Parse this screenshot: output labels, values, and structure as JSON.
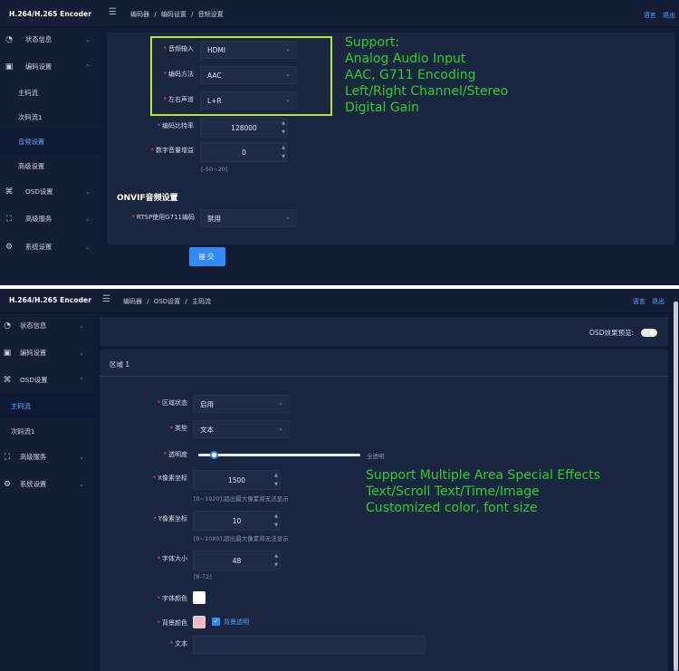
{
  "top": {
    "brand": "H.264/H.265 Encoder",
    "breadcrumb": [
      "编码器",
      "/",
      "编码设置",
      "/",
      "音频设置"
    ],
    "links": [
      "语言",
      "退出"
    ],
    "sidebar": [
      {
        "label": "状态信息",
        "icon": "gauge-icon"
      },
      {
        "label": "编码设置",
        "icon": "monitor-icon"
      },
      {
        "label": "主码流",
        "icon": ""
      },
      {
        "label": "次码流1",
        "icon": ""
      },
      {
        "label": "音频设置",
        "icon": ""
      },
      {
        "label": "高级设置",
        "icon": ""
      },
      {
        "label": "OSD设置",
        "icon": "osd-icon"
      },
      {
        "label": "高级服务",
        "icon": "service-icon"
      },
      {
        "label": "系统设置",
        "icon": "gear-icon"
      }
    ],
    "form": {
      "audio_input_label": "音频输入",
      "audio_input_value": "HDMI",
      "codec_label": "编码方法",
      "codec_value": "AAC",
      "channel_label": "左右声道",
      "channel_value": "L+R",
      "bitrate_label": "编码比特率",
      "bitrate_value": "128000",
      "gain_label": "数字音量增益",
      "gain_value": "0",
      "gain_hint": "[-50~20]",
      "onvif_title": "ONVIF音频设置",
      "rtsp_label": "RTSP使用G711编码",
      "rtsp_value": "禁用",
      "submit": "提交"
    },
    "annotation": "Support:\nAnalog Audio Input\nAAC, G711 Encoding\nLeft/Right Channel/Stereo\nDigital Gain"
  },
  "bottom": {
    "brand": "H.264/H.265 Encoder",
    "breadcrumb": [
      "编码器",
      "/",
      "OSD设置",
      "/",
      "主码流"
    ],
    "links": [
      "语言",
      "退出"
    ],
    "sidebar": [
      {
        "label": "状态信息",
        "icon": "gauge-icon"
      },
      {
        "label": "编码设置",
        "icon": "monitor-icon"
      },
      {
        "label": "OSD设置",
        "icon": "osd-icon"
      },
      {
        "label": "主码流",
        "icon": ""
      },
      {
        "label": "次码流1",
        "icon": ""
      },
      {
        "label": "高级服务",
        "icon": "service-icon"
      },
      {
        "label": "系统设置",
        "icon": "gear-icon"
      }
    ],
    "preview_label": "OSD效果预览:",
    "area_title": "区域 1",
    "form": {
      "state_label": "区域状态",
      "state_value": "启用",
      "type_label": "类型",
      "type_value": "文本",
      "opacity_label": "透明度",
      "opacity_right": "全透明",
      "opacity_fraction": 0.1,
      "x_label": "X像素坐标",
      "x_value": "1500",
      "x_hint": "[0~1920],超出最大像素将无法显示",
      "y_label": "Y像素坐标",
      "y_value": "10",
      "y_hint": "[0~1080],超出最大像素将无法显示",
      "size_label": "字体大小",
      "size_value": "48",
      "size_hint": "[8-72]",
      "color_label": "字体颜色",
      "font_color": "#ffffff",
      "bg_label": "背景颜色",
      "bg_color": "#f2b8c6",
      "bg_transparent_label": "背景透明",
      "text_label": "文本"
    },
    "annotation": "Support Multiple Area Special Effects\nText/Scroll Text/Time/Image\nCustomized color, font size"
  }
}
